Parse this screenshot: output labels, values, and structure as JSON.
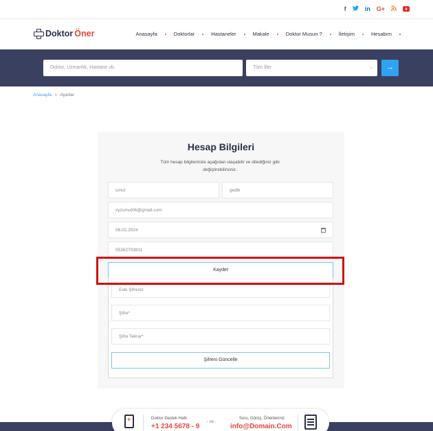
{
  "social": [
    "f",
    "t",
    "in",
    "G+",
    "rss",
    "yt"
  ],
  "brand": {
    "part1": "Doktor",
    "part2": "Öner"
  },
  "nav": [
    "Anasayfa",
    "Doktorlar",
    "Hastaneler",
    "Makale",
    "Doktor Musun ?",
    "İletişim",
    "Hesabım"
  ],
  "search": {
    "placeholder": "Doktor, Uzmanlık, Hastane vb.",
    "city": "Tüm İller",
    "button_icon": "→"
  },
  "breadcrumb": {
    "home": "Anasayfa",
    "arrow": "›",
    "current": "Ayarlar"
  },
  "card": {
    "title": "Hesap Bilgileri",
    "description": "Tüm hesap bilgilerinize aşağıdan ulaşabilir ve dilediğiniz gibi değiştirebilirsiniz.",
    "first_name": "umut",
    "last_name": "gedik",
    "email": "xyzumut06@gmail.com",
    "birth_date": "06.02.2024",
    "phone": "05362703811",
    "save_label": "Kaydet",
    "old_password": "Eski Şifreniz",
    "new_password": "Şifre*",
    "repeat_password": "Şifre Tekrar*",
    "update_password_label": "Şifreni Güncelle"
  },
  "support": {
    "left_title": "Doktor Destek Hattı",
    "left_value": "+1 234 5678 - 9",
    "separator": "- ve -",
    "right_title": "Soru, Görüş, Önerileriniz",
    "right_value": "info@Domain.Com"
  },
  "colors": {
    "accent": "#2ea3f2",
    "brand_red": "#e8453c",
    "navy": "#3a4060",
    "highlight": "#d10f0f"
  }
}
